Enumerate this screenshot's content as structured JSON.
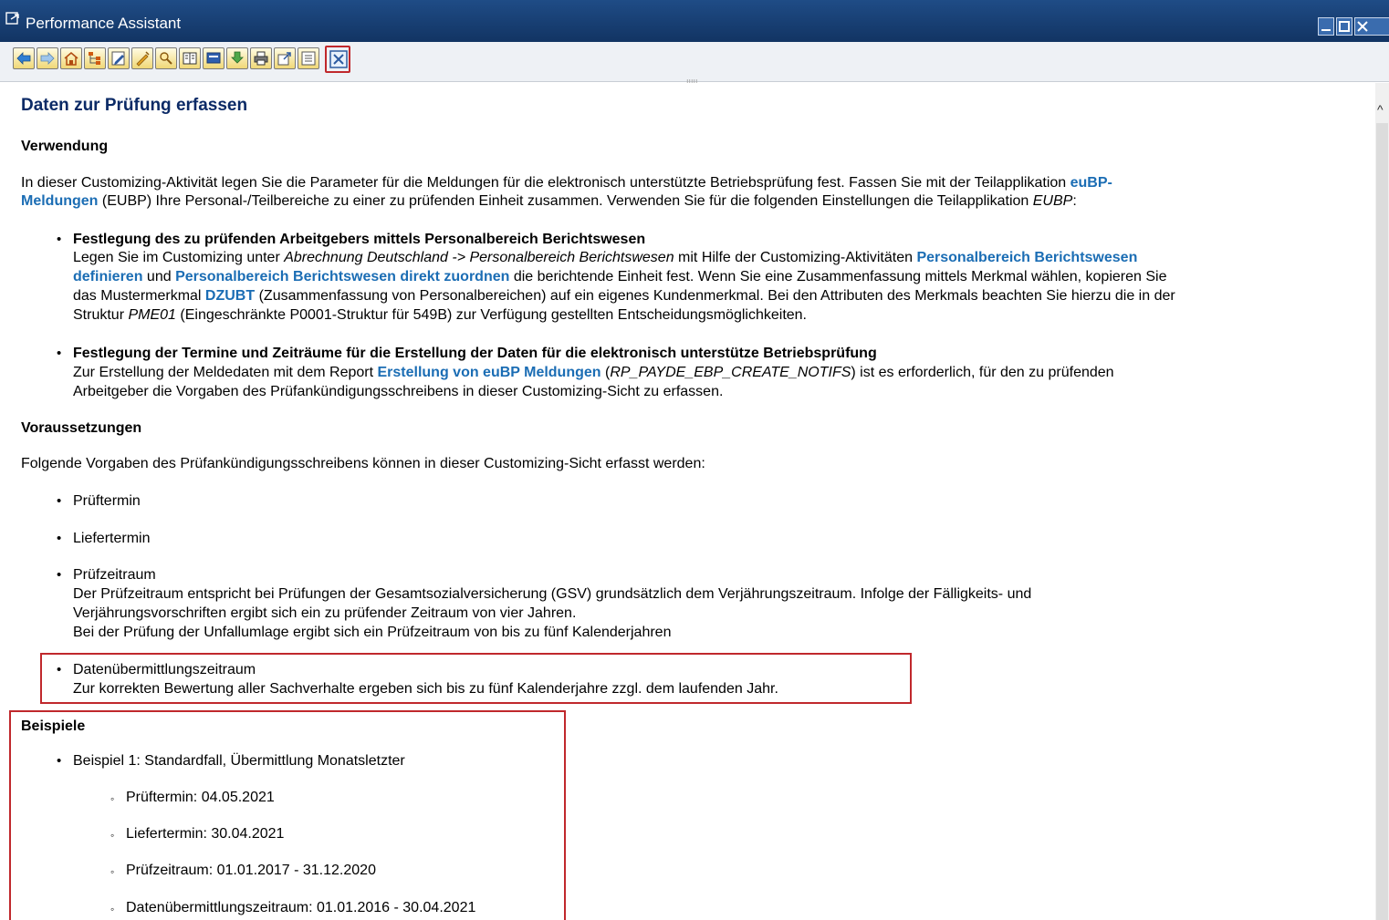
{
  "window": {
    "title": "Performance Assistant"
  },
  "toolbar": {
    "buttons": [
      "back-icon",
      "forward-icon",
      "home-icon",
      "structure-icon",
      "edit-icon",
      "highlight-icon",
      "find-icon",
      "book-icon",
      "display-icon",
      "download-icon",
      "print-icon",
      "export-icon",
      "settings-icon",
      "close-icon"
    ]
  },
  "doc": {
    "title": "Daten zur Prüfung erfassen",
    "verwendung": {
      "heading": "Verwendung",
      "intro_l1_a": "In dieser Customizing-Aktivität legen Sie die Parameter für die Meldungen für die elektronisch unterstützte Betriebsprüfung fest. Fassen Sie mit der Teilapplikation ",
      "intro_l1_link": "euBP-",
      "intro_l2_link": "Meldungen",
      "intro_l2_b": " (EUBP) Ihre Personal-/Teilbereiche zu einer zu prüfenden Einheit zusammen. Verwenden Sie für die folgenden Einstellungen die Teilapplikation ",
      "intro_l2_italic": "EUBP",
      "intro_l2_c": ":",
      "item1": {
        "title": "Festlegung des zu prüfenden Arbeitgebers mittels Personalbereich Berichtswesen",
        "l1_a": "Legen Sie im Customizing unter ",
        "l1_italic": "Abrechnung Deutschland -> Personalbereich Berichtswesen",
        "l1_b": " mit Hilfe der Customizing-Aktivitäten ",
        "l1_link": "Personalbereich Berichtswesen",
        "l2_link1": "definieren",
        "l2_a": " und ",
        "l2_link2": "Personalbereich Berichtswesen direkt zuordnen",
        "l2_b": " die berichtende Einheit fest. Wenn Sie eine Zusammenfassung mittels Merkmal wählen, kopieren Sie",
        "l3_a": "das Mustermerkmal ",
        "l3_link": "DZUBT",
        "l3_b": " (Zusammenfassung von Personalbereichen) auf ein eigenes Kundenmerkmal. Bei den Attributen des Merkmals beachten Sie hierzu die in der",
        "l4_a": "Struktur ",
        "l4_italic": "PME01",
        "l4_b": " (Eingeschränkte P0001-Struktur für 549B) zur Verfügung gestellten Entscheidungsmöglichkeiten."
      },
      "item2": {
        "title": "Festlegung der Termine und Zeiträume für die Erstellung der Daten für die elektronisch unterstütze Betriebsprüfung",
        "l1_a": "Zur Erstellung der Meldedaten mit dem Report ",
        "l1_link": "Erstellung von euBP Meldungen",
        "l1_b": " (",
        "l1_italic": "RP_PAYDE_EBP_CREATE_NOTIFS",
        "l1_c": ") ist es erforderlich, für den zu prüfenden",
        "l2": "Arbeitgeber die Vorgaben des Prüfankündigungsschreibens in dieser Customizing-Sicht zu erfassen."
      }
    },
    "voraussetzungen": {
      "heading": "Voraussetzungen",
      "intro": "Folgende Vorgaben des Prüfankündigungsschreibens können in dieser Customizing-Sicht erfasst werden:",
      "b1": "Prüftermin",
      "b2": "Liefertermin",
      "b3": "Prüfzeitraum",
      "b3_l1": "Der Prüfzeitraum entspricht bei Prüfungen der Gesamtsozialversicherung (GSV) grundsätzlich dem Verjährungszeitraum. Infolge der Fälligkeits- und",
      "b3_l2": "Verjährungsvorschriften ergibt sich ein zu prüfender Zeitraum von vier Jahren.",
      "b3_l3": "Bei der Prüfung der Unfallumlage ergibt sich ein Prüfzeitraum von bis zu fünf Kalenderjahren",
      "b4": "Datenübermittlungszeitraum",
      "b4_l1": "Zur korrekten Bewertung aller Sachverhalte ergeben sich bis zu fünf Kalenderjahre zzgl. dem laufenden Jahr."
    },
    "beispiele": {
      "heading": "Beispiele",
      "ex1": "Beispiel 1: Standardfall, Übermittlung Monatsletzter",
      "s1": "Prüftermin: 04.05.2021",
      "s2": "Liefertermin: 30.04.2021",
      "s3": "Prüfzeitraum: 01.01.2017 - 31.12.2020",
      "s4": "Datenübermittlungszeitraum: 01.01.2016 - 30.04.2021"
    },
    "bullet": "•",
    "subbullet": "◦"
  }
}
